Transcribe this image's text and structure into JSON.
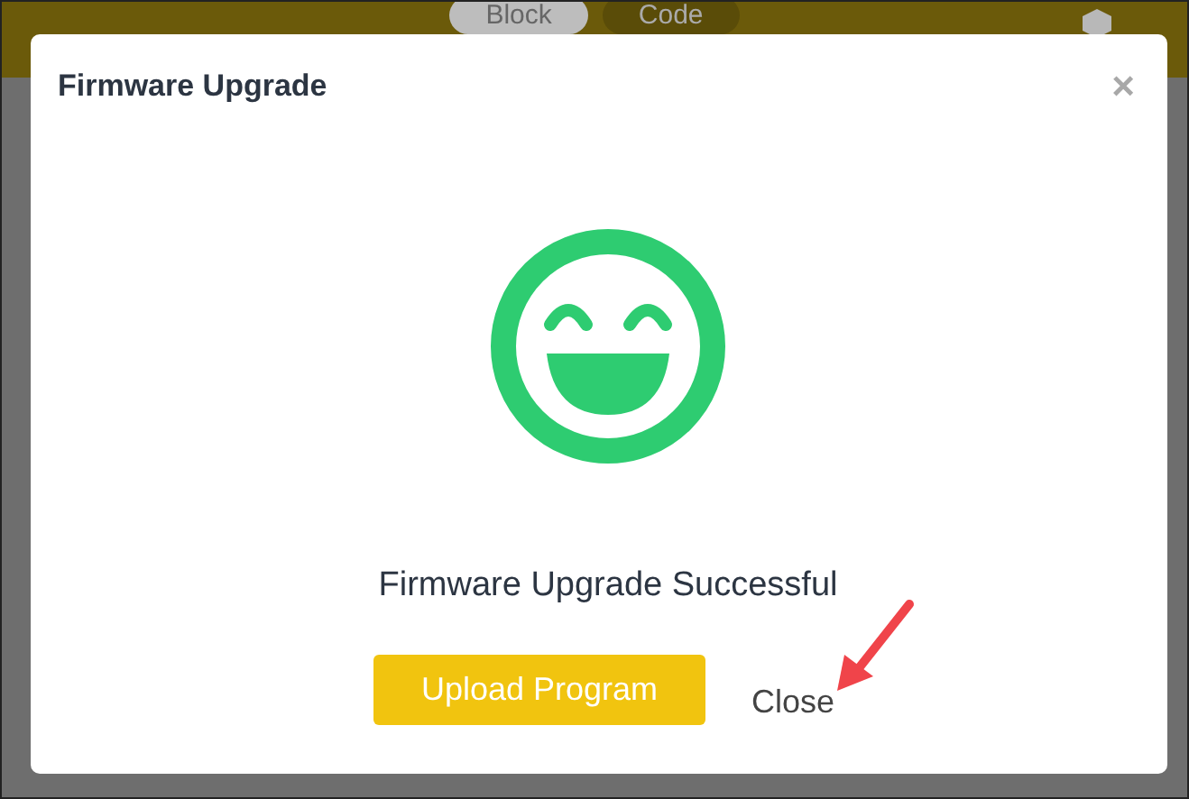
{
  "background_tabs": [
    {
      "label": "Block",
      "selected": true
    },
    {
      "label": "Code",
      "selected": false
    }
  ],
  "dialog": {
    "title": "Firmware Upgrade",
    "close": "×",
    "message": "Firmware Upgrade Successful",
    "buttons": [
      {
        "label": "Upload Program",
        "kind": "primary"
      },
      {
        "label": "Close",
        "kind": "link"
      }
    ]
  }
}
